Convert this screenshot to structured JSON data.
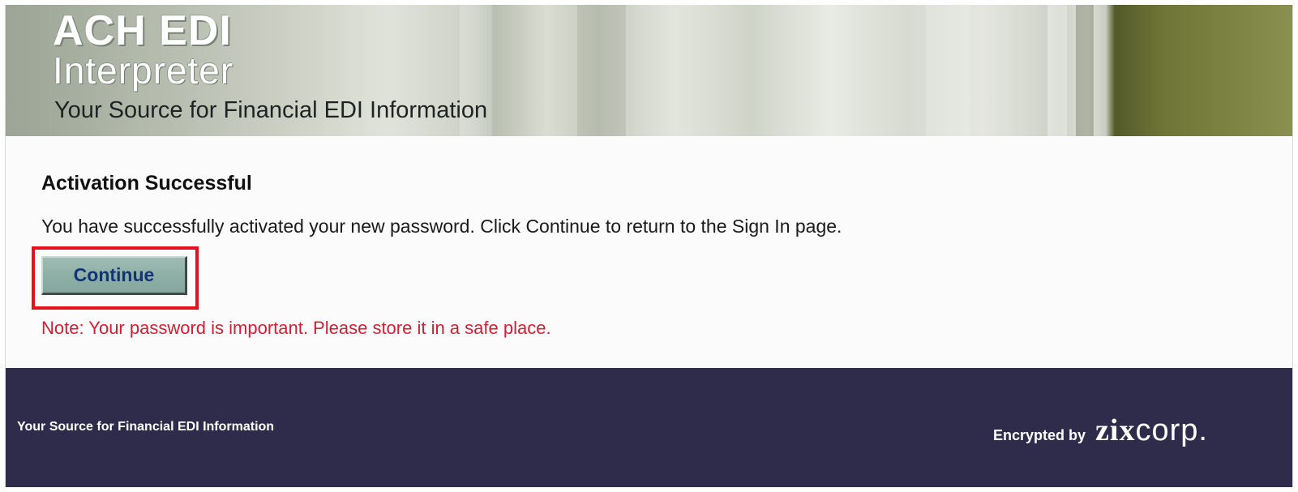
{
  "banner": {
    "logo_line1": "ACH EDI",
    "logo_line2": "Interpreter",
    "tagline": "Your Source for Financial EDI Information"
  },
  "main": {
    "heading": "Activation Successful",
    "message": "You have successfully activated your new password. Click Continue to return to the Sign In page.",
    "continue_label": "Continue",
    "note": "Note: Your password is important. Please store it in a safe place."
  },
  "footer": {
    "tagline": "Your Source for Financial EDI Information",
    "encrypted_label": "Encrypted by",
    "vendor_logo_part1": "zix",
    "vendor_logo_part2": "corp."
  },
  "colors": {
    "footer_bg": "#2f2c4b",
    "note_text": "#d21f35",
    "button_bg": "#8fb0a7",
    "button_text": "#12337a",
    "highlight_border": "#e8101a"
  }
}
